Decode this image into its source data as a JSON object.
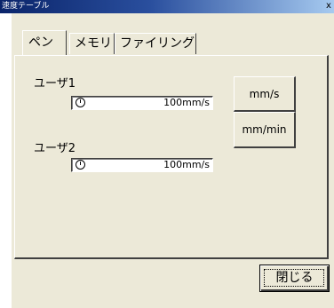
{
  "window": {
    "title": "速度テーブル",
    "close_glyph": "x"
  },
  "tabs": [
    {
      "label": "ペン",
      "active": true
    },
    {
      "label": "メモリ",
      "active": false
    },
    {
      "label": "ファイリング",
      "active": false
    }
  ],
  "user1": {
    "label": "ユーザ1",
    "value": "100mm/s"
  },
  "user2": {
    "label": "ユーザ2",
    "value": "100mm/s"
  },
  "unit_buttons": {
    "mm_s": "mm/s",
    "mm_min": "mm/min"
  },
  "footer": {
    "close_label": "閉じる"
  }
}
